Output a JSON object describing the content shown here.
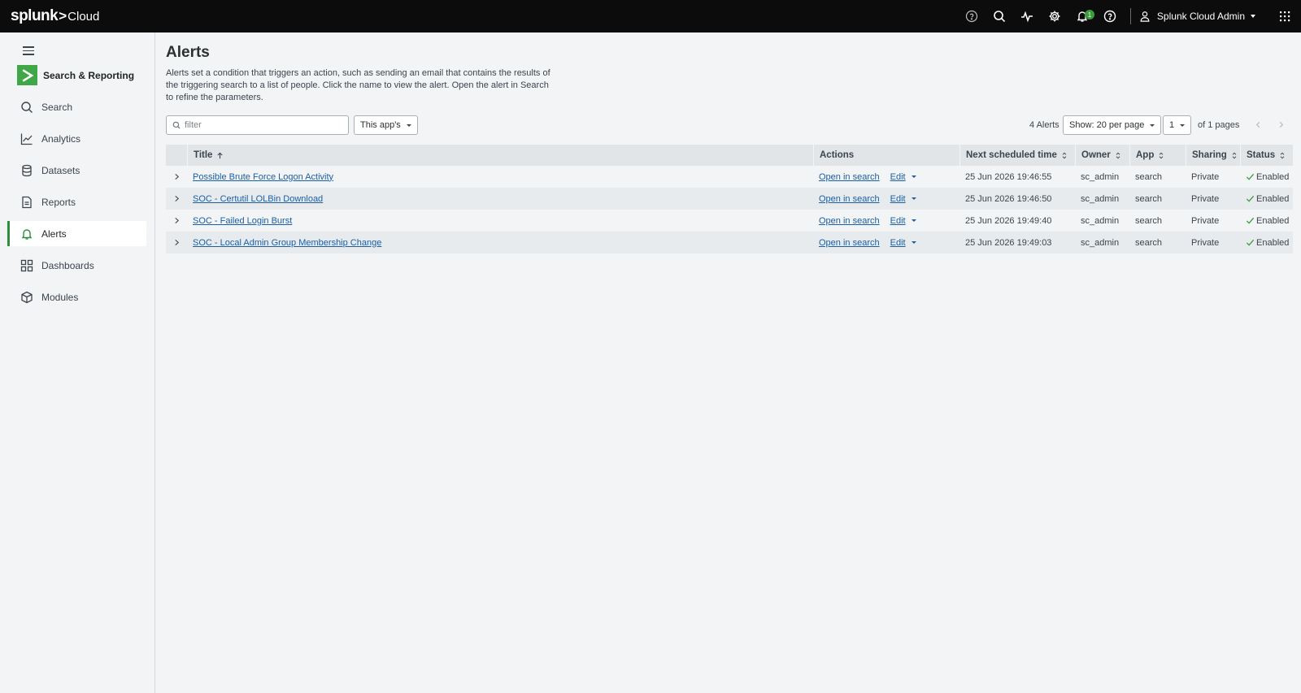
{
  "topbar": {
    "logo_brand": "splunk",
    "logo_gt": ">",
    "logo_product": "Cloud",
    "notification_count": "1",
    "user_name": "Splunk Cloud Admin",
    "icons": [
      "help-outline-icon",
      "search-icon",
      "activity-icon",
      "gear-icon",
      "bell-icon",
      "help-circle-icon",
      "user-icon",
      "apps-grid-icon"
    ]
  },
  "sidebar": {
    "app_name": "Search & Reporting",
    "items": [
      {
        "label": "Search",
        "icon": "search-icon"
      },
      {
        "label": "Analytics",
        "icon": "analytics-icon"
      },
      {
        "label": "Datasets",
        "icon": "datasets-icon"
      },
      {
        "label": "Reports",
        "icon": "reports-icon"
      },
      {
        "label": "Alerts",
        "icon": "bell-icon",
        "active": true
      },
      {
        "label": "Dashboards",
        "icon": "dashboards-icon"
      },
      {
        "label": "Modules",
        "icon": "modules-icon"
      }
    ]
  },
  "main": {
    "title": "Alerts",
    "description": "Alerts set a condition that triggers an action, such as sending an email that contains the results of the triggering search to a list of people. Click the name to view the alert. Open the alert in Search to refine the parameters.",
    "filter_placeholder": "filter",
    "app_filter": "This app's",
    "count_text": "4 Alerts",
    "per_page": "Show: 20 per page",
    "page": "1",
    "page_total": "of 1 pages"
  },
  "table": {
    "headers": {
      "title": "Title",
      "actions": "Actions",
      "next_scheduled": "Next scheduled time",
      "owner": "Owner",
      "app": "App",
      "sharing": "Sharing",
      "status": "Status"
    },
    "open_in_search_label": "Open in search",
    "edit_label": "Edit",
    "rows": [
      {
        "title": "Possible Brute Force Logon Activity",
        "next": "25 Jun 2026 19:46:55",
        "owner": "sc_admin",
        "app": "search",
        "sharing": "Private",
        "status": "Enabled"
      },
      {
        "title": "SOC - Certutil LOLBin Download",
        "next": "25 Jun 2026 19:46:50",
        "owner": "sc_admin",
        "app": "search",
        "sharing": "Private",
        "status": "Enabled"
      },
      {
        "title": "SOC - Failed Login Burst",
        "next": "25 Jun 2026 19:49:40",
        "owner": "sc_admin",
        "app": "search",
        "sharing": "Private",
        "status": "Enabled"
      },
      {
        "title": "SOC - Local Admin Group Membership Change",
        "next": "25 Jun 2026 19:49:03",
        "owner": "sc_admin",
        "app": "search",
        "sharing": "Private",
        "status": "Enabled"
      }
    ]
  },
  "colors": {
    "topbar_bg": "#0c0c0c",
    "accent_green": "#3fa747",
    "link_blue": "#1a5fa3",
    "page_bg": "#f2f4f5",
    "status_green": "#3c9b3c"
  }
}
